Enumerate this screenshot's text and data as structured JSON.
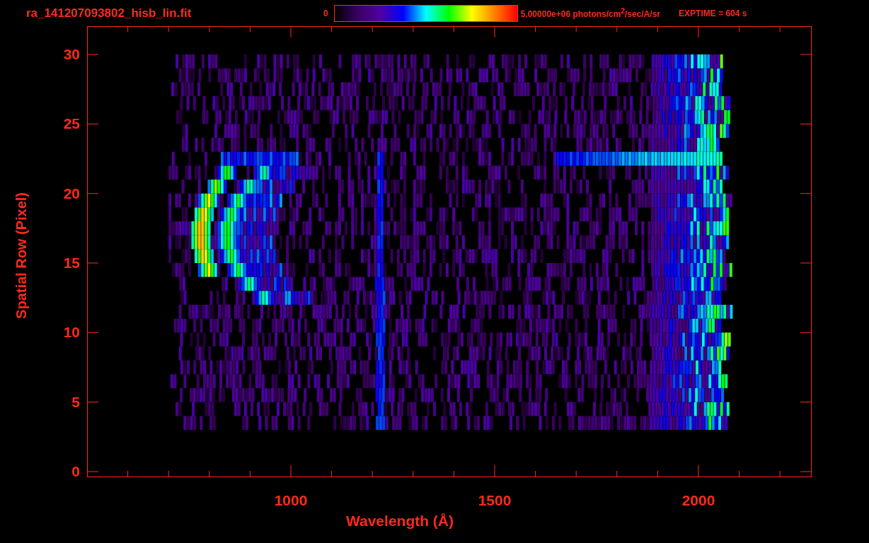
{
  "title": "ra_141207093802_hisb_lin.fit",
  "colorbar": {
    "min_label": "0",
    "max_label": "5.00000e+06 photons/cm$^{2}$/sec/A/sr"
  },
  "exposure": "EXPTIME = 604 s",
  "plot": {
    "ylabel": "Spatial Row (Pixel)",
    "xlabel": "Wavelength (Å)",
    "yticks": [
      "30",
      "25",
      "20",
      "15",
      "10",
      "5",
      "0"
    ],
    "xticks": [
      "1000",
      "1500",
      "2000"
    ]
  }
}
